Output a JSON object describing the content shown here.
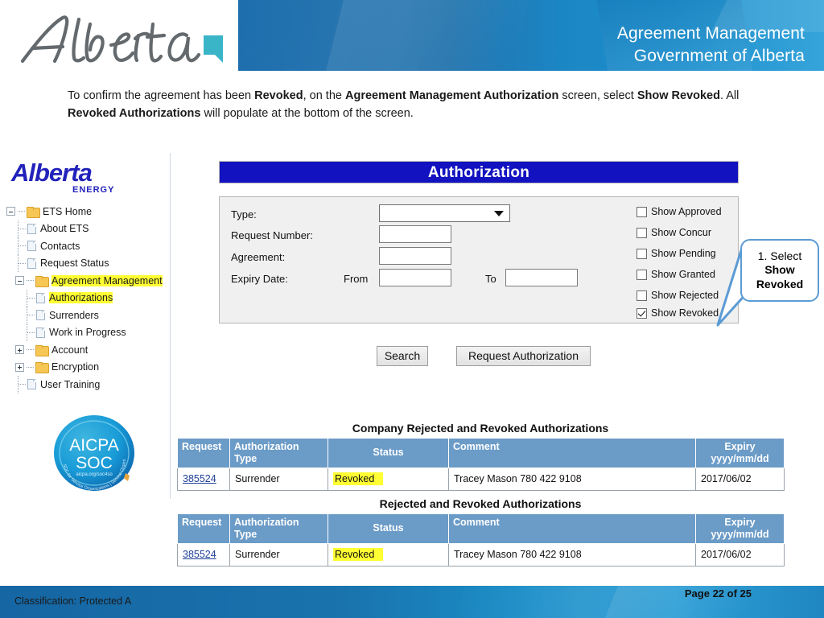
{
  "header": {
    "logo_alt": "Alberta",
    "title_line1": "Agreement Management",
    "title_line2": "Government of Alberta",
    "banner_color": "#1b86c4"
  },
  "instructions": {
    "part1": "To confirm the agreement has been ",
    "bold1": "Revoked",
    "part2": ", on the ",
    "bold2": "Agreement Management Authorization",
    "part3": " screen, select ",
    "bold3": "Show Revoked",
    "part4": ".  All ",
    "bold4": "Revoked Authorizations",
    "part5": " will populate at the bottom of the screen."
  },
  "sidebar": {
    "logo_text": "Alberta",
    "logo_sub": "ENERGY",
    "items": [
      {
        "label": "ETS Home",
        "type": "folder",
        "toggle": "minus",
        "level": 0
      },
      {
        "label": "About ETS",
        "type": "page",
        "toggle": "none",
        "level": 1
      },
      {
        "label": "Contacts",
        "type": "page",
        "toggle": "none",
        "level": 1
      },
      {
        "label": "Request Status",
        "type": "page",
        "toggle": "none",
        "level": 1
      },
      {
        "label": "Agreement Management",
        "type": "folder",
        "toggle": "minus",
        "level": 1,
        "highlight": true
      },
      {
        "label": "Authorizations",
        "type": "page",
        "toggle": "none",
        "level": 2,
        "highlight": true
      },
      {
        "label": "Surrenders",
        "type": "page",
        "toggle": "none",
        "level": 2
      },
      {
        "label": "Work in Progress",
        "type": "page",
        "toggle": "none",
        "level": 2
      },
      {
        "label": "Account",
        "type": "folder",
        "toggle": "plus",
        "level": 0
      },
      {
        "label": "Encryption",
        "type": "folder",
        "toggle": "plus",
        "level": 0
      },
      {
        "label": "User Training",
        "type": "page",
        "toggle": "none",
        "level": 0
      }
    ],
    "badge": {
      "line1": "AICPA",
      "line2": "SOC",
      "line3": "aicpa.org/soc4so",
      "arc_text": "SOC for Service Organizations | Service Organizations"
    }
  },
  "auth_panel": {
    "title": "Authorization",
    "fields": {
      "type_label": "Type:",
      "type_value": "",
      "request_number_label": "Request Number:",
      "request_number_value": "",
      "agreement_label": "Agreement:",
      "agreement_value": "",
      "expiry_label": "Expiry Date:",
      "from_label": "From",
      "from_value": "",
      "to_label": "To",
      "to_value": ""
    },
    "checkboxes": [
      {
        "label": "Show Approved",
        "checked": false
      },
      {
        "label": "Show Concur",
        "checked": false
      },
      {
        "label": "Show Pending",
        "checked": false
      },
      {
        "label": "Show Granted",
        "checked": false
      },
      {
        "label": "Show Rejected",
        "checked": false
      },
      {
        "label": "Show Revoked",
        "checked": true
      }
    ],
    "buttons": {
      "search": "Search",
      "request_authorization": "Request Authorization"
    }
  },
  "callout": {
    "line1": "1. Select",
    "line2": "Show",
    "line3": "Revoked",
    "border_color": "#5b9bd5"
  },
  "tables": [
    {
      "caption": "Company Rejected and Revoked Authorizations",
      "columns": [
        "Request",
        "Authorization\nType",
        "Status",
        "Comment",
        "Expiry\nyyyy/mm/dd"
      ],
      "col_request": "Request",
      "col_type_l1": "Authorization",
      "col_type_l2": "Type",
      "col_status": "Status",
      "col_comment": "Comment",
      "col_expiry_l1": "Expiry",
      "col_expiry_l2": "yyyy/mm/dd",
      "rows": [
        {
          "request": "385524",
          "type": "Surrender",
          "status": "Revoked",
          "comment": "Tracey Mason 780 422 9108",
          "expiry": "2017/06/02"
        }
      ]
    },
    {
      "caption": "Rejected and Revoked Authorizations",
      "columns": [
        "Request",
        "Authorization\nType",
        "Status",
        "Comment",
        "Expiry\nyyyy/mm/dd"
      ],
      "col_request": "Request",
      "col_type_l1": "Authorization",
      "col_type_l2": "Type",
      "col_status": "Status",
      "col_comment": "Comment",
      "col_expiry_l1": "Expiry",
      "col_expiry_l2": "yyyy/mm/dd",
      "rows": [
        {
          "request": "385524",
          "type": "Surrender",
          "status": "Revoked",
          "comment": "Tracey Mason 780 422 9108",
          "expiry": "2017/06/02"
        }
      ]
    }
  ],
  "footer": {
    "classification": "Classification: Protected A",
    "page": "Page 22 of 25"
  }
}
